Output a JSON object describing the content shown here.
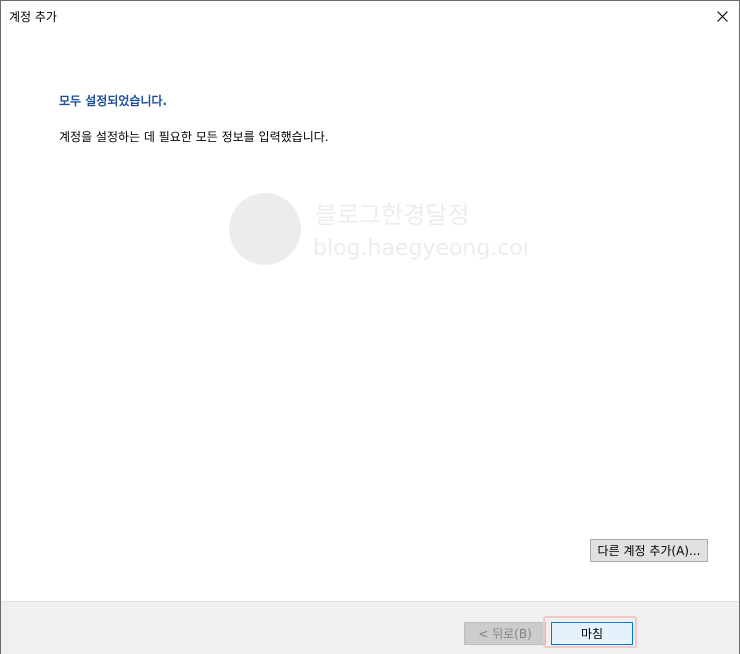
{
  "window": {
    "title": "계정 추가"
  },
  "main": {
    "heading": "모두 설정되었습니다.",
    "description": "계정을 설정하는 데 필요한 모든 정보를 입력했습니다.",
    "add_account_label": "다른 계정 추가(A)..."
  },
  "watermark": {
    "title": "블로그한경달정",
    "url": "blog.haegyeong.com"
  },
  "footer": {
    "back_label": "< 뒤로(B)",
    "finish_label": "마침"
  },
  "colors": {
    "heading": "#1e4e9c",
    "finish_border": "#0078d7",
    "highlight": "#f2c9c9"
  },
  "icons": {
    "close": "close-icon"
  }
}
